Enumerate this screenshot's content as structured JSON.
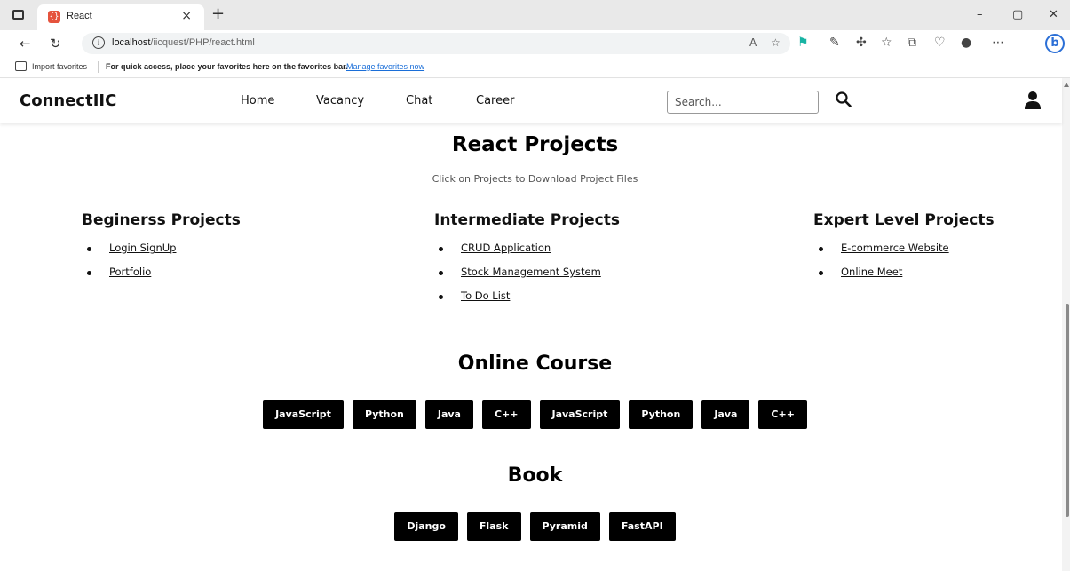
{
  "browser": {
    "tab_title": "React",
    "tab_icon_glyph": "{}",
    "tab_close": "×",
    "new_tab": "+",
    "win_min": "–",
    "win_restore": "▢",
    "win_close": "✕",
    "url_host": "localhost",
    "url_path": "/iicquest/PHP/react.html",
    "info_glyph": "i",
    "fav_import": "Import favorites",
    "fav_message": "For quick access, place your favorites here on the favorites bar.",
    "fav_manage": "Manage favorites now",
    "bing_glyph": "b"
  },
  "site": {
    "logo": "ConnectIIC",
    "nav": [
      "Home",
      "Vacancy",
      "Chat",
      "Career"
    ],
    "search_placeholder": "Search..."
  },
  "projects": {
    "title": "React Projects",
    "subtitle": "Click on Projects to Download Project Files",
    "columns": [
      {
        "heading": "Beginerss Projects",
        "items": [
          "Login SignUp",
          "Portfolio"
        ]
      },
      {
        "heading": "Intermediate Projects",
        "items": [
          "CRUD Application",
          "Stock Management System",
          "To Do List"
        ]
      },
      {
        "heading": "Expert Level Projects",
        "items": [
          "E-commerce Website",
          "Online Meet"
        ]
      }
    ]
  },
  "course": {
    "title": "Online Course",
    "buttons": [
      "JavaScript",
      "Python",
      "Java",
      "C++",
      "JavaScript",
      "Python",
      "Java",
      "C++"
    ]
  },
  "book": {
    "title": "Book",
    "buttons": [
      "Django",
      "Flask",
      "Pyramid",
      "FastAPI"
    ]
  },
  "colors": {
    "accent": "#000000",
    "link": "#1a6ed8",
    "tab_icon": "#e5533d"
  }
}
